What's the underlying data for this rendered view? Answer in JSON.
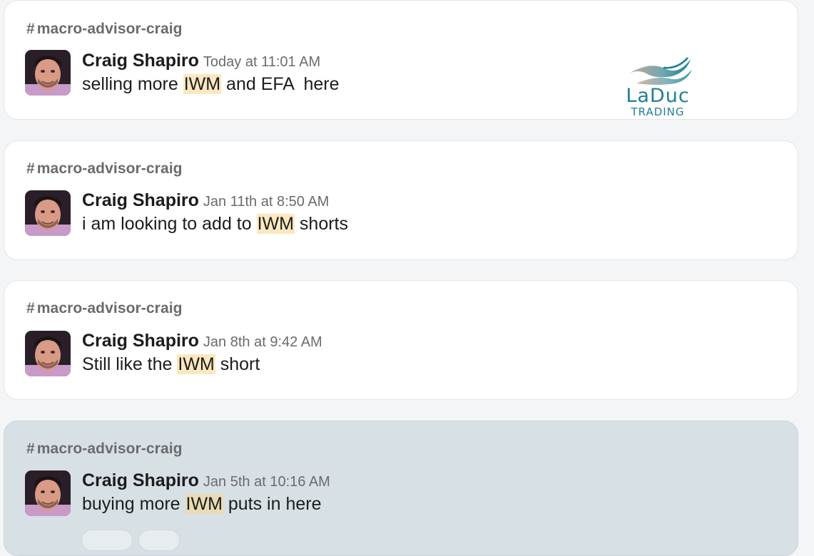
{
  "messages": [
    {
      "channel": "macro-advisor-craig",
      "author": "Craig Shapiro",
      "timestamp": "Today at 11:01 AM",
      "text_before": "selling more ",
      "ticker": "IWM",
      "text_after": " and EFA  here"
    },
    {
      "channel": "macro-advisor-craig",
      "author": "Craig Shapiro",
      "timestamp": "Jan 11th at 8:50 AM",
      "text_before": "i am looking to add to ",
      "ticker": "IWM",
      "text_after": " shorts"
    },
    {
      "channel": "macro-advisor-craig",
      "author": "Craig Shapiro",
      "timestamp": "Jan 8th at 9:42 AM",
      "text_before": "Still like the ",
      "ticker": "IWM",
      "text_after": " short"
    },
    {
      "channel": "macro-advisor-craig",
      "author": "Craig Shapiro",
      "timestamp": "Jan 5th at 10:16 AM",
      "text_before": "buying more ",
      "ticker": "IWM",
      "text_after": " puts in here"
    }
  ],
  "watermark": {
    "word": "LaDuc",
    "sub": "TRADING"
  },
  "colors": {
    "ticker_highlight": "#fbe8bf",
    "selected_card": "#d7e0e5",
    "logo_teal": "#217f91"
  },
  "icons": {
    "channel": "hash-icon"
  }
}
